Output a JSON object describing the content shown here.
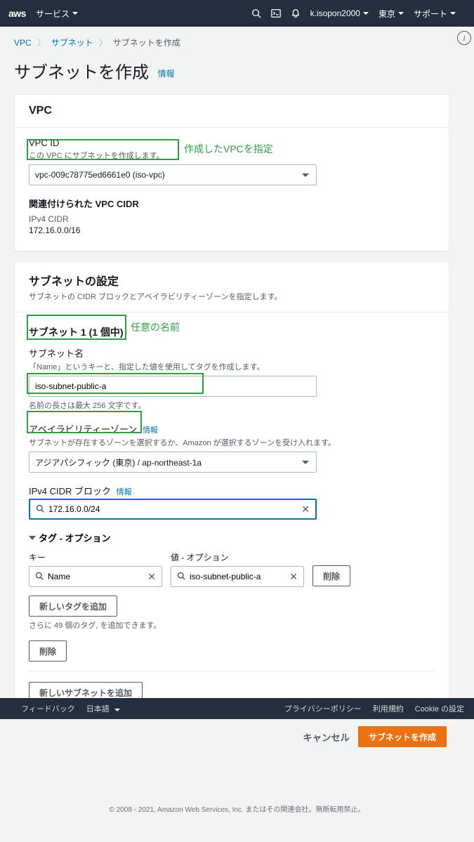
{
  "nav": {
    "logo": "aws",
    "services": "サービス",
    "user": "k.isopon2000",
    "region": "東京",
    "support": "サポート"
  },
  "breadcrumb": {
    "vpc": "VPC",
    "subnet": "サブネット",
    "current": "サブネットを作成"
  },
  "page": {
    "title": "サブネットを作成",
    "info": "情報"
  },
  "vpc_panel": {
    "title": "VPC",
    "vpc_id_label": "VPC ID",
    "vpc_id_help": "この VPC にサブネットを作成します。",
    "vpc_id_value": "vpc-009c78775ed6661e0 (iso-vpc)",
    "assoc_cidr_label": "関連付けられた VPC CIDR",
    "ipv4_cidr_label": "IPv4 CIDR",
    "ipv4_cidr_value": "172.16.0.0/16"
  },
  "subnet_panel": {
    "title": "サブネットの設定",
    "subtitle": "サブネットの CIDR ブロックとアベイラビリティーゾーンを指定します。",
    "subnet_heading": "サブネット 1 (1 個中)",
    "name_label": "サブネット名",
    "name_help": "「Name」というキーと、指定した値を使用してタグを作成します。",
    "name_value": "iso-subnet-public-a",
    "name_constraint": "名前の長さは最大 256 文字です。",
    "az_label": "アベイラビリティーゾーン",
    "az_info": "情報",
    "az_help": "サブネットが存在するゾーンを選択するか、Amazon が選択するゾーンを受け入れます。",
    "az_value": "アジアパシフィック (東京) / ap-northeast-1a",
    "cidr_label": "IPv4 CIDR ブロック",
    "cidr_info": "情報",
    "cidr_value": "172.16.0.0/24",
    "tags_toggle": "タグ - オプション",
    "tag_key_label": "キー",
    "tag_value_label": "値 - オプション",
    "tag_key": "Name",
    "tag_value": "iso-subnet-public-a",
    "remove_btn": "削除",
    "add_tag_btn": "新しいタグを追加",
    "tag_limit": "さらに 49 個のタグ, を追加できます。",
    "delete_btn": "削除"
  },
  "add_subnet_btn": "新しいサブネットを追加",
  "cancel_btn": "キャンセル",
  "create_btn": "サブネットを作成",
  "footer": {
    "feedback": "フィードバック",
    "language": "日本語",
    "privacy": "プライバシーポリシー",
    "terms": "利用規約",
    "cookie": "Cookie の設定",
    "copyright": "© 2008 - 2021, Amazon Web Services, Inc. またはその関連会社。無断転用禁止。"
  },
  "annotations": {
    "vpc_note": "作成したVPCを指定",
    "name_note": "任意の名前"
  }
}
